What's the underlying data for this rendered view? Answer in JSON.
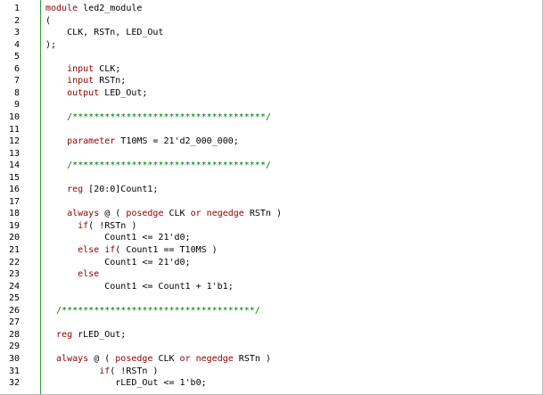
{
  "colors": {
    "keyword": "#8b0000",
    "identifier": "#000000",
    "comment": "#007700",
    "line_number": "#000000",
    "gutter_rule": "#2e9e3e",
    "background": "#ffffff"
  },
  "lines": [
    {
      "n": "1",
      "tokens": [
        {
          "t": "module ",
          "c": "kw"
        },
        {
          "t": "led2_module",
          "c": "tok"
        }
      ]
    },
    {
      "n": "2",
      "tokens": [
        {
          "t": "(",
          "c": "tok"
        }
      ]
    },
    {
      "n": "3",
      "tokens": [
        {
          "t": "    CLK, RSTn, LED_Out",
          "c": "tok"
        }
      ]
    },
    {
      "n": "4",
      "tokens": [
        {
          "t": ");",
          "c": "tok"
        }
      ]
    },
    {
      "n": "5",
      "tokens": []
    },
    {
      "n": "6",
      "tokens": [
        {
          "t": "    ",
          "c": "tok"
        },
        {
          "t": "input",
          "c": "kw"
        },
        {
          "t": " CLK;",
          "c": "tok"
        }
      ]
    },
    {
      "n": "7",
      "tokens": [
        {
          "t": "    ",
          "c": "tok"
        },
        {
          "t": "input",
          "c": "kw"
        },
        {
          "t": " RSTn;",
          "c": "tok"
        }
      ]
    },
    {
      "n": "8",
      "tokens": [
        {
          "t": "    ",
          "c": "tok"
        },
        {
          "t": "output",
          "c": "kw"
        },
        {
          "t": " LED_Out;",
          "c": "tok"
        }
      ]
    },
    {
      "n": "9",
      "tokens": []
    },
    {
      "n": "10",
      "tokens": [
        {
          "t": "    ",
          "c": "tok"
        },
        {
          "t": "/************************************/",
          "c": "cm"
        }
      ]
    },
    {
      "n": "11",
      "tokens": []
    },
    {
      "n": "12",
      "tokens": [
        {
          "t": "    ",
          "c": "tok"
        },
        {
          "t": "parameter",
          "c": "kw"
        },
        {
          "t": " T10MS = 21'd2_000_000;",
          "c": "tok"
        }
      ]
    },
    {
      "n": "13",
      "tokens": []
    },
    {
      "n": "14",
      "tokens": [
        {
          "t": "    ",
          "c": "tok"
        },
        {
          "t": "/************************************/",
          "c": "cm"
        }
      ]
    },
    {
      "n": "15",
      "tokens": []
    },
    {
      "n": "16",
      "tokens": [
        {
          "t": "    ",
          "c": "tok"
        },
        {
          "t": "reg",
          "c": "kw"
        },
        {
          "t": " [20:0]Count1;",
          "c": "tok"
        }
      ]
    },
    {
      "n": "17",
      "tokens": []
    },
    {
      "n": "18",
      "tokens": [
        {
          "t": "    ",
          "c": "tok"
        },
        {
          "t": "always",
          "c": "kw"
        },
        {
          "t": " @ ( ",
          "c": "tok"
        },
        {
          "t": "posedge",
          "c": "kw"
        },
        {
          "t": " CLK ",
          "c": "tok"
        },
        {
          "t": "or",
          "c": "kw"
        },
        {
          "t": " ",
          "c": "tok"
        },
        {
          "t": "negedge",
          "c": "kw"
        },
        {
          "t": " RSTn )",
          "c": "tok"
        }
      ]
    },
    {
      "n": "19",
      "tokens": [
        {
          "t": "      ",
          "c": "tok"
        },
        {
          "t": "if",
          "c": "kw"
        },
        {
          "t": "( !RSTn )",
          "c": "tok"
        }
      ]
    },
    {
      "n": "20",
      "tokens": [
        {
          "t": "           Count1 <= 21'd0;",
          "c": "tok"
        }
      ]
    },
    {
      "n": "21",
      "tokens": [
        {
          "t": "      ",
          "c": "tok"
        },
        {
          "t": "else if",
          "c": "kw"
        },
        {
          "t": "( Count1 == T10MS )",
          "c": "tok"
        }
      ]
    },
    {
      "n": "22",
      "tokens": [
        {
          "t": "           Count1 <= 21'd0;",
          "c": "tok"
        }
      ]
    },
    {
      "n": "23",
      "tokens": [
        {
          "t": "      ",
          "c": "tok"
        },
        {
          "t": "else",
          "c": "kw"
        }
      ]
    },
    {
      "n": "24",
      "tokens": [
        {
          "t": "           Count1 <= Count1 + 1'b1;",
          "c": "tok"
        }
      ]
    },
    {
      "n": "25",
      "tokens": []
    },
    {
      "n": "26",
      "tokens": [
        {
          "t": "  ",
          "c": "tok"
        },
        {
          "t": "/************************************/",
          "c": "cm"
        }
      ]
    },
    {
      "n": "27",
      "tokens": []
    },
    {
      "n": "28",
      "tokens": [
        {
          "t": "  ",
          "c": "tok"
        },
        {
          "t": "reg",
          "c": "kw"
        },
        {
          "t": " rLED_Out;",
          "c": "tok"
        }
      ]
    },
    {
      "n": "29",
      "tokens": []
    },
    {
      "n": "30",
      "tokens": [
        {
          "t": "  ",
          "c": "tok"
        },
        {
          "t": "always",
          "c": "kw"
        },
        {
          "t": " @ ( ",
          "c": "tok"
        },
        {
          "t": "posedge",
          "c": "kw"
        },
        {
          "t": " CLK ",
          "c": "tok"
        },
        {
          "t": "or",
          "c": "kw"
        },
        {
          "t": " ",
          "c": "tok"
        },
        {
          "t": "negedge",
          "c": "kw"
        },
        {
          "t": " RSTn )",
          "c": "tok"
        }
      ]
    },
    {
      "n": "31",
      "tokens": [
        {
          "t": "          ",
          "c": "tok"
        },
        {
          "t": "if",
          "c": "kw"
        },
        {
          "t": "( !RSTn )",
          "c": "tok"
        }
      ]
    },
    {
      "n": "32",
      "tokens": [
        {
          "t": "             rLED_Out <= 1'b0;",
          "c": "tok"
        }
      ]
    }
  ]
}
